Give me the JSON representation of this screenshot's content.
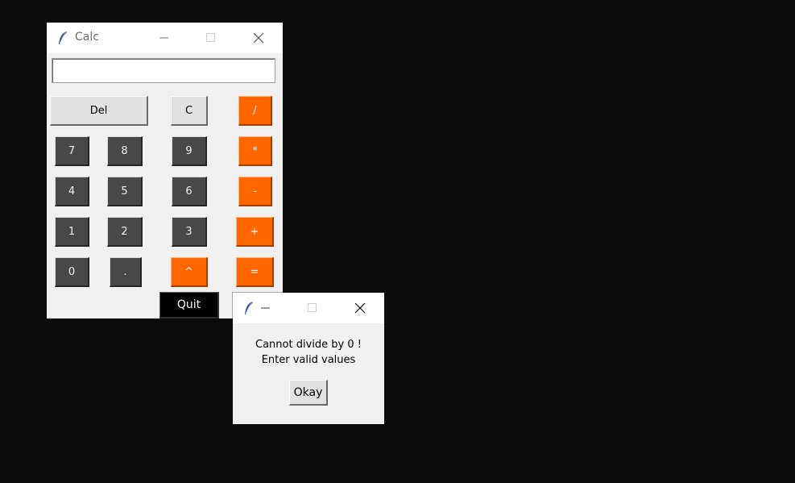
{
  "calc_window": {
    "title": "Calc",
    "app_icon": "feather-icon",
    "title_controls": [
      "minimize-icon",
      "maximize-icon",
      "close-icon"
    ],
    "entry_value": "",
    "buttons": {
      "del": "Del",
      "clear": "C",
      "divide": "/",
      "seven": "7",
      "eight": "8",
      "nine": "9",
      "multiply": "*",
      "four": "4",
      "five": "5",
      "six": "6",
      "minus": "-",
      "one": "1",
      "two": "2",
      "three": "3",
      "plus": "+",
      "zero": "0",
      "dot": ".",
      "power": "^",
      "equals": "=",
      "quit": "Quit"
    }
  },
  "dialog_window": {
    "app_icon": "feather-icon",
    "title_controls": [
      "minimize-icon",
      "maximize-icon",
      "close-icon"
    ],
    "message_line1": "Cannot divide by 0 !",
    "message_line2": "Enter valid values",
    "ok_label": "Okay"
  },
  "colors": {
    "background": "#0c0c0c",
    "window_bg": "#f0f0f0",
    "digit_button": "#484848",
    "operator_button": "#ff6600",
    "light_button": "#e1e1e1",
    "quit_button": "#000000"
  }
}
